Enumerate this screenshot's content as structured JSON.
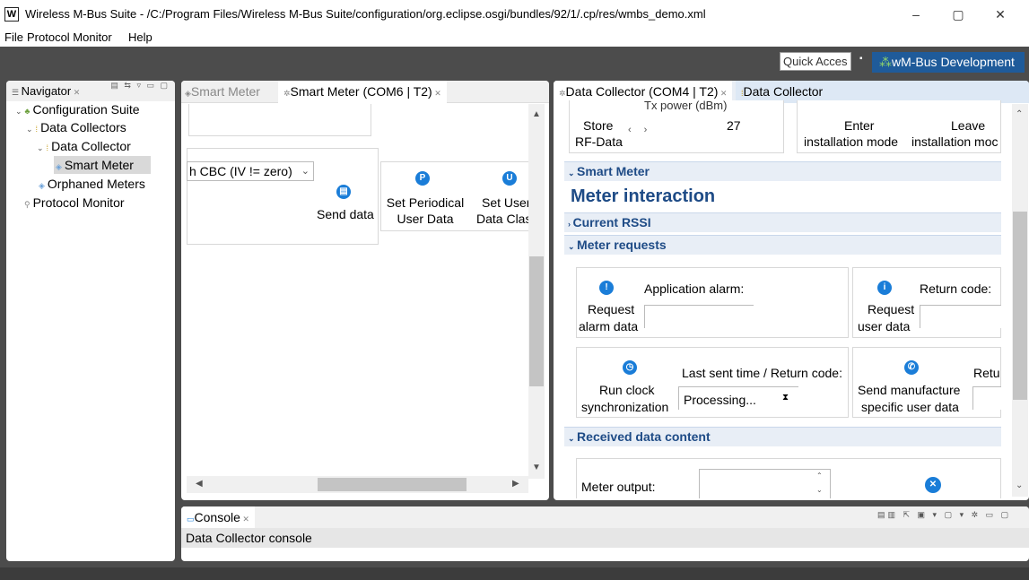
{
  "window": {
    "title": "Wireless M-Bus Suite - /C:/Program Files/Wireless M-Bus Suite/configuration/org.eclipse.osgi/bundles/92/1/.cp/res/wmbs_demo.xml",
    "minimize": "–",
    "maximize": "▢",
    "close": "✕"
  },
  "menu": [
    "File",
    "Protocol Monitor",
    "Help"
  ],
  "toolbar": {
    "quick_access": "Quick Acces",
    "perspective": "wM-Bus Development"
  },
  "navigator": {
    "title": "Navigator",
    "tree": [
      {
        "label": "Configuration Suite",
        "selected": false
      },
      {
        "label": "Data Collectors",
        "selected": false
      },
      {
        "label": "Data Collector",
        "selected": false
      },
      {
        "label": "Smart Meter",
        "selected": true
      },
      {
        "label": "Orphaned Meters",
        "selected": false
      },
      {
        "label": "Protocol Monitor",
        "selected": false
      }
    ]
  },
  "left_editor": {
    "tabs": [
      "Smart Meter",
      "Smart Meter (COM6 | T2)"
    ],
    "combo_value": "h CBC (IV != zero)",
    "send_data": "Send data",
    "set_periodical_line1": "Set Periodical",
    "set_periodical_line2": "User Data",
    "set_user_line1": "Set User",
    "set_user_line2": "Data Clas"
  },
  "right_editor": {
    "tabs": [
      "Data Collector (COM4 | T2)",
      "Data Collector"
    ],
    "tx_power_label": "Tx power (dBm)",
    "tx_power_value": "27",
    "store_line1": "Store",
    "store_line2": "RF-Data",
    "enter_line1": "Enter",
    "enter_line2": "installation mode",
    "leave_line1": "Leave",
    "leave_line2": "installation moc",
    "smart_meter_section": "Smart Meter",
    "heading": "Meter interaction",
    "current_rssi": "Current RSSI",
    "meter_requests": "Meter requests",
    "application_alarm": "Application alarm:",
    "request_alarm_line1": "Request",
    "request_alarm_line2": "alarm data",
    "return_code": "Return code:",
    "request_user_line1": "Request",
    "request_user_line2": "user data",
    "last_sent_time": "Last sent time / Return code:",
    "run_clock_line1": "Run clock",
    "run_clock_line2": "synchronization",
    "processing": "Processing...",
    "retu": "Retu",
    "send_manuf_line1": "Send manufacture",
    "send_manuf_line2": "specific user data",
    "received_data": "Received data content",
    "meter_output": "Meter output:"
  },
  "console": {
    "title": "Console",
    "content": "Data Collector console"
  },
  "colors": {
    "accent": "#1a7dd8",
    "section_text": "#1e4b86",
    "perspective_bg": "#1f5b9a",
    "workbench_bg": "#4c4c4c"
  }
}
